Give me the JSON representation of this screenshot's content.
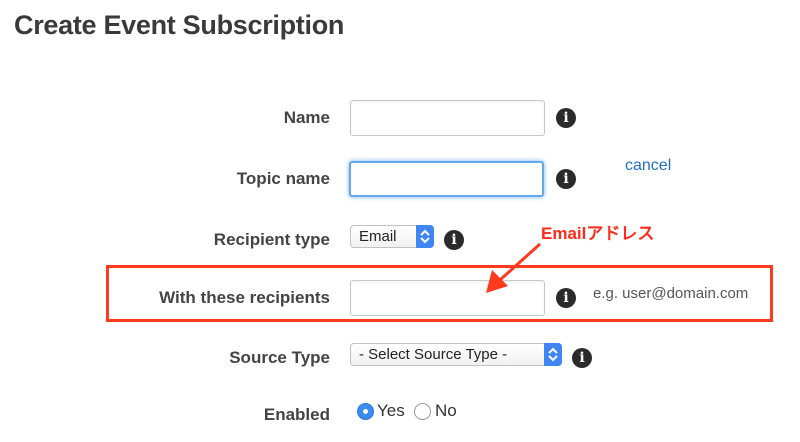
{
  "page": {
    "title": "Create Event Subscription"
  },
  "form": {
    "name": {
      "label": "Name",
      "value": ""
    },
    "topic_name": {
      "label": "Topic name",
      "value": "",
      "cancel_label": "cancel"
    },
    "recipient_type": {
      "label": "Recipient type",
      "selected": "Email"
    },
    "recipients": {
      "label": "With these recipients",
      "value": "",
      "hint": "e.g. user@domain.com"
    },
    "source_type": {
      "label": "Source Type",
      "selected": "- Select Source Type -"
    },
    "enabled": {
      "label": "Enabled",
      "options": [
        "Yes",
        "No"
      ],
      "selected": "Yes"
    },
    "info_glyph": "i"
  },
  "annotation": {
    "text": "Emailアドレス",
    "color": "#ff3a1f"
  },
  "colors": {
    "accent": "#3f86f2",
    "link": "#1f6fc3",
    "focus": "#66a8ee"
  },
  "icons": [
    "info-icon",
    "select-arrows-icon",
    "radio-icon",
    "arrow-annotation"
  ]
}
